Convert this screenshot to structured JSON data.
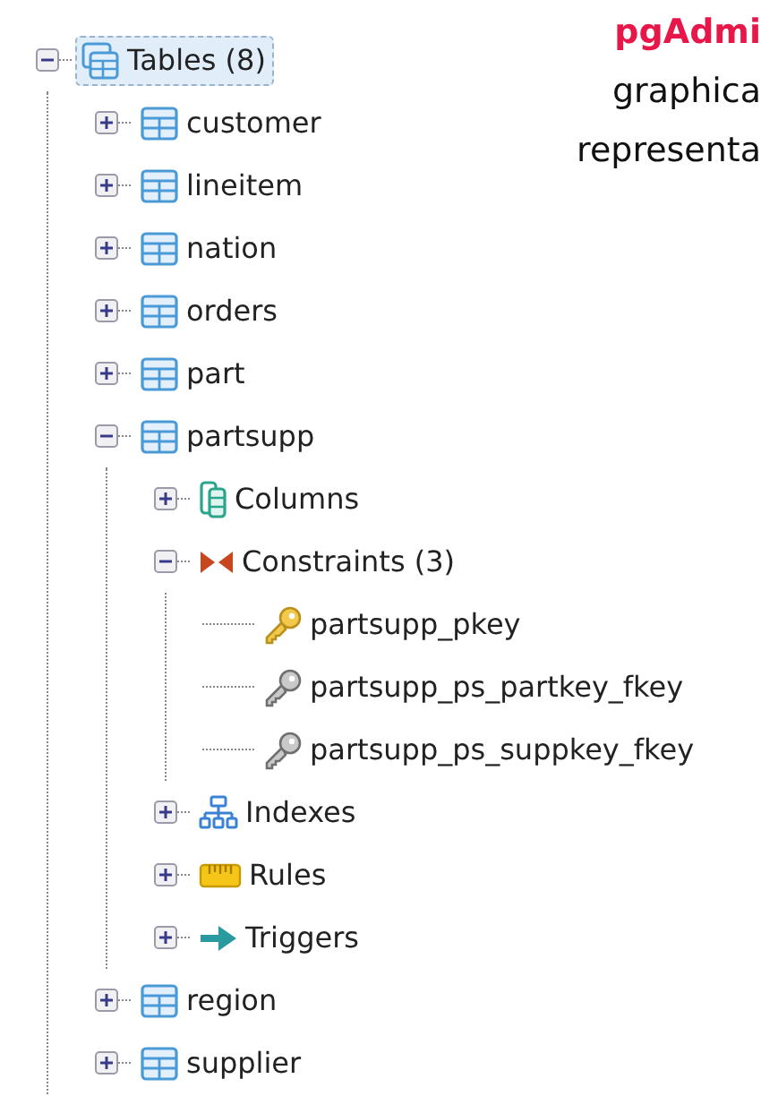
{
  "tree": [
    {
      "label": "Tables (8)",
      "kind": "tables",
      "expanded": true,
      "selected": true,
      "children": [
        {
          "label": "customer",
          "kind": "table",
          "expanded": false,
          "selected": false
        },
        {
          "label": "lineitem",
          "kind": "table",
          "expanded": false,
          "selected": false
        },
        {
          "label": "nation",
          "kind": "table",
          "expanded": false,
          "selected": false
        },
        {
          "label": "orders",
          "kind": "table",
          "expanded": false,
          "selected": false
        },
        {
          "label": "part",
          "kind": "table",
          "expanded": false,
          "selected": false
        },
        {
          "label": "partsupp",
          "kind": "table",
          "expanded": true,
          "selected": false,
          "children": [
            {
              "label": "Columns",
              "kind": "columns",
              "expanded": false,
              "selected": false
            },
            {
              "label": "Constraints (3)",
              "kind": "constraints",
              "expanded": true,
              "selected": false,
              "children": [
                {
                  "label": "partsupp_pkey",
                  "kind": "primary-key",
                  "selected": false
                },
                {
                  "label": "partsupp_ps_partkey_fkey",
                  "kind": "foreign-key",
                  "selected": false
                },
                {
                  "label": "partsupp_ps_suppkey_fkey",
                  "kind": "foreign-key",
                  "selected": false
                }
              ]
            },
            {
              "label": "Indexes",
              "kind": "indexes",
              "expanded": false,
              "selected": false
            },
            {
              "label": "Rules",
              "kind": "rules",
              "expanded": false,
              "selected": false
            },
            {
              "label": "Triggers",
              "kind": "triggers",
              "expanded": false,
              "selected": false
            }
          ]
        },
        {
          "label": "region",
          "kind": "table",
          "expanded": false,
          "selected": false
        },
        {
          "label": "supplier",
          "kind": "table",
          "expanded": false,
          "selected": false
        }
      ]
    }
  ],
  "caption": [
    {
      "text": "pgAdmi",
      "kind": "title"
    },
    {
      "text": "graphica",
      "kind": "body"
    },
    {
      "text": "representa",
      "kind": "body"
    }
  ]
}
